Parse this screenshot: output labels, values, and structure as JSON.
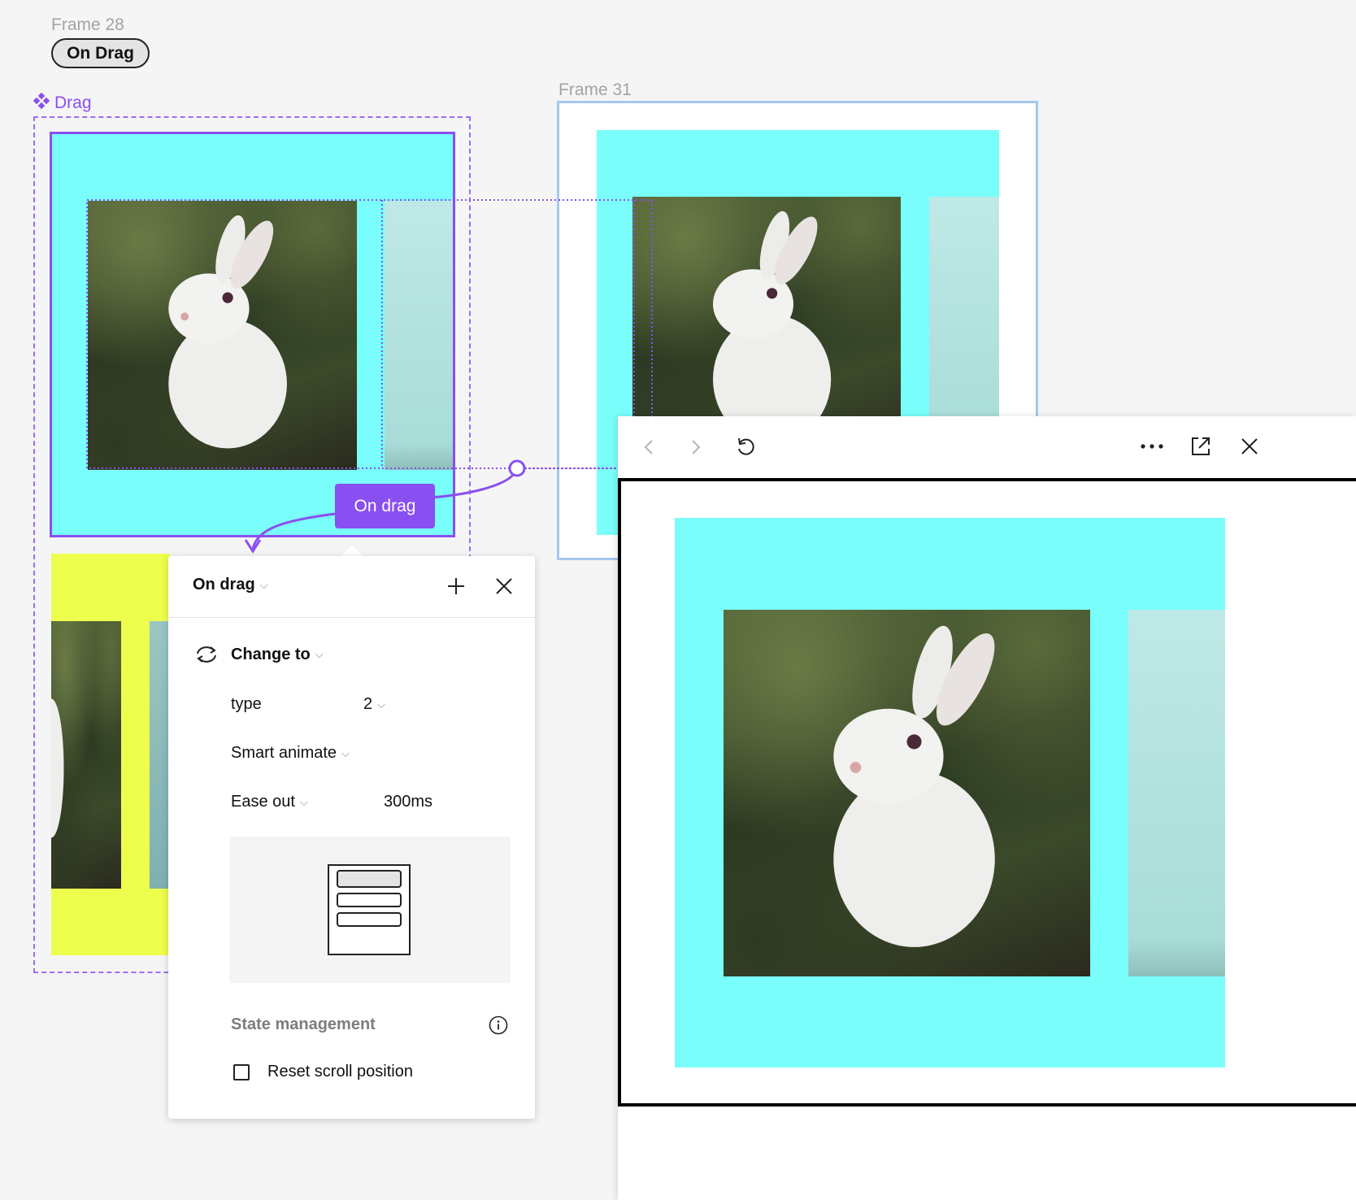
{
  "canvas": {
    "frame28_label": "Frame 28",
    "on_drag_pill": "On Drag",
    "component_label": "Drag",
    "frame31_label": "Frame 31",
    "connector_label": "On drag"
  },
  "popover": {
    "trigger": "On drag",
    "action": "Change to",
    "property_name": "type",
    "property_value": "2",
    "animation": "Smart animate",
    "easing": "Ease out",
    "duration": "300ms",
    "state_management": "State management",
    "reset_scroll": "Reset scroll position",
    "reset_scroll_checked": false
  },
  "preview": {
    "icons": [
      "chevron-left-icon",
      "chevron-right-icon",
      "restart-icon",
      "more-icon",
      "open-external-icon",
      "close-icon"
    ]
  },
  "colors": {
    "accent_purple": "#8a4ff0",
    "cyan": "#79fefb",
    "yellow": "#eefe4d",
    "frame_selection_blue": "#a6c8f0"
  }
}
